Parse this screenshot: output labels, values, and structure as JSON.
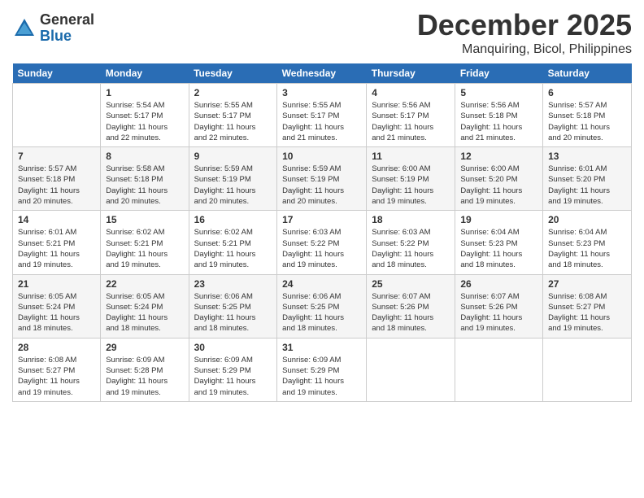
{
  "logo": {
    "general": "General",
    "blue": "Blue"
  },
  "title": "December 2025",
  "location": "Manquiring, Bicol, Philippines",
  "days_header": [
    "Sunday",
    "Monday",
    "Tuesday",
    "Wednesday",
    "Thursday",
    "Friday",
    "Saturday"
  ],
  "weeks": [
    [
      {
        "day": "",
        "info": ""
      },
      {
        "day": "1",
        "info": "Sunrise: 5:54 AM\nSunset: 5:17 PM\nDaylight: 11 hours\nand 22 minutes."
      },
      {
        "day": "2",
        "info": "Sunrise: 5:55 AM\nSunset: 5:17 PM\nDaylight: 11 hours\nand 22 minutes."
      },
      {
        "day": "3",
        "info": "Sunrise: 5:55 AM\nSunset: 5:17 PM\nDaylight: 11 hours\nand 21 minutes."
      },
      {
        "day": "4",
        "info": "Sunrise: 5:56 AM\nSunset: 5:17 PM\nDaylight: 11 hours\nand 21 minutes."
      },
      {
        "day": "5",
        "info": "Sunrise: 5:56 AM\nSunset: 5:18 PM\nDaylight: 11 hours\nand 21 minutes."
      },
      {
        "day": "6",
        "info": "Sunrise: 5:57 AM\nSunset: 5:18 PM\nDaylight: 11 hours\nand 20 minutes."
      }
    ],
    [
      {
        "day": "7",
        "info": "Sunrise: 5:57 AM\nSunset: 5:18 PM\nDaylight: 11 hours\nand 20 minutes."
      },
      {
        "day": "8",
        "info": "Sunrise: 5:58 AM\nSunset: 5:18 PM\nDaylight: 11 hours\nand 20 minutes."
      },
      {
        "day": "9",
        "info": "Sunrise: 5:59 AM\nSunset: 5:19 PM\nDaylight: 11 hours\nand 20 minutes."
      },
      {
        "day": "10",
        "info": "Sunrise: 5:59 AM\nSunset: 5:19 PM\nDaylight: 11 hours\nand 20 minutes."
      },
      {
        "day": "11",
        "info": "Sunrise: 6:00 AM\nSunset: 5:19 PM\nDaylight: 11 hours\nand 19 minutes."
      },
      {
        "day": "12",
        "info": "Sunrise: 6:00 AM\nSunset: 5:20 PM\nDaylight: 11 hours\nand 19 minutes."
      },
      {
        "day": "13",
        "info": "Sunrise: 6:01 AM\nSunset: 5:20 PM\nDaylight: 11 hours\nand 19 minutes."
      }
    ],
    [
      {
        "day": "14",
        "info": "Sunrise: 6:01 AM\nSunset: 5:21 PM\nDaylight: 11 hours\nand 19 minutes."
      },
      {
        "day": "15",
        "info": "Sunrise: 6:02 AM\nSunset: 5:21 PM\nDaylight: 11 hours\nand 19 minutes."
      },
      {
        "day": "16",
        "info": "Sunrise: 6:02 AM\nSunset: 5:21 PM\nDaylight: 11 hours\nand 19 minutes."
      },
      {
        "day": "17",
        "info": "Sunrise: 6:03 AM\nSunset: 5:22 PM\nDaylight: 11 hours\nand 19 minutes."
      },
      {
        "day": "18",
        "info": "Sunrise: 6:03 AM\nSunset: 5:22 PM\nDaylight: 11 hours\nand 18 minutes."
      },
      {
        "day": "19",
        "info": "Sunrise: 6:04 AM\nSunset: 5:23 PM\nDaylight: 11 hours\nand 18 minutes."
      },
      {
        "day": "20",
        "info": "Sunrise: 6:04 AM\nSunset: 5:23 PM\nDaylight: 11 hours\nand 18 minutes."
      }
    ],
    [
      {
        "day": "21",
        "info": "Sunrise: 6:05 AM\nSunset: 5:24 PM\nDaylight: 11 hours\nand 18 minutes."
      },
      {
        "day": "22",
        "info": "Sunrise: 6:05 AM\nSunset: 5:24 PM\nDaylight: 11 hours\nand 18 minutes."
      },
      {
        "day": "23",
        "info": "Sunrise: 6:06 AM\nSunset: 5:25 PM\nDaylight: 11 hours\nand 18 minutes."
      },
      {
        "day": "24",
        "info": "Sunrise: 6:06 AM\nSunset: 5:25 PM\nDaylight: 11 hours\nand 18 minutes."
      },
      {
        "day": "25",
        "info": "Sunrise: 6:07 AM\nSunset: 5:26 PM\nDaylight: 11 hours\nand 18 minutes."
      },
      {
        "day": "26",
        "info": "Sunrise: 6:07 AM\nSunset: 5:26 PM\nDaylight: 11 hours\nand 19 minutes."
      },
      {
        "day": "27",
        "info": "Sunrise: 6:08 AM\nSunset: 5:27 PM\nDaylight: 11 hours\nand 19 minutes."
      }
    ],
    [
      {
        "day": "28",
        "info": "Sunrise: 6:08 AM\nSunset: 5:27 PM\nDaylight: 11 hours\nand 19 minutes."
      },
      {
        "day": "29",
        "info": "Sunrise: 6:09 AM\nSunset: 5:28 PM\nDaylight: 11 hours\nand 19 minutes."
      },
      {
        "day": "30",
        "info": "Sunrise: 6:09 AM\nSunset: 5:29 PM\nDaylight: 11 hours\nand 19 minutes."
      },
      {
        "day": "31",
        "info": "Sunrise: 6:09 AM\nSunset: 5:29 PM\nDaylight: 11 hours\nand 19 minutes."
      },
      {
        "day": "",
        "info": ""
      },
      {
        "day": "",
        "info": ""
      },
      {
        "day": "",
        "info": ""
      }
    ]
  ]
}
